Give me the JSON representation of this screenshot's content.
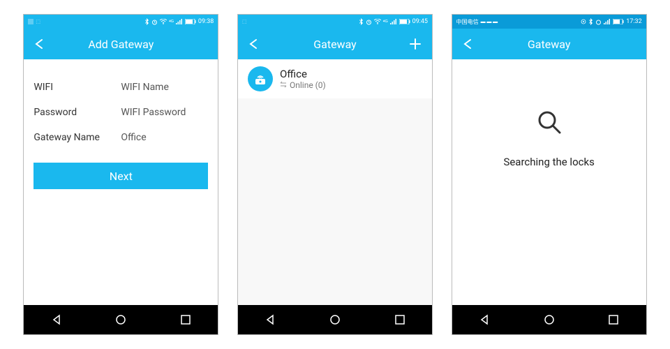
{
  "screen1": {
    "status_time": "09:38",
    "title": "Add Gateway",
    "wifi_label": "WIFI",
    "wifi_value": "WIFI Name",
    "password_label": "Password",
    "password_value": "WIFI Password",
    "gateway_name_label": "Gateway Name",
    "gateway_name_value": "Office",
    "next_button": "Next"
  },
  "screen2": {
    "status_time": "09:45",
    "title": "Gateway",
    "item_name": "Office",
    "item_status": "Online (0)"
  },
  "screen3": {
    "status_time": "17:32",
    "title": "Gateway",
    "searching_text": "Searching the locks"
  }
}
